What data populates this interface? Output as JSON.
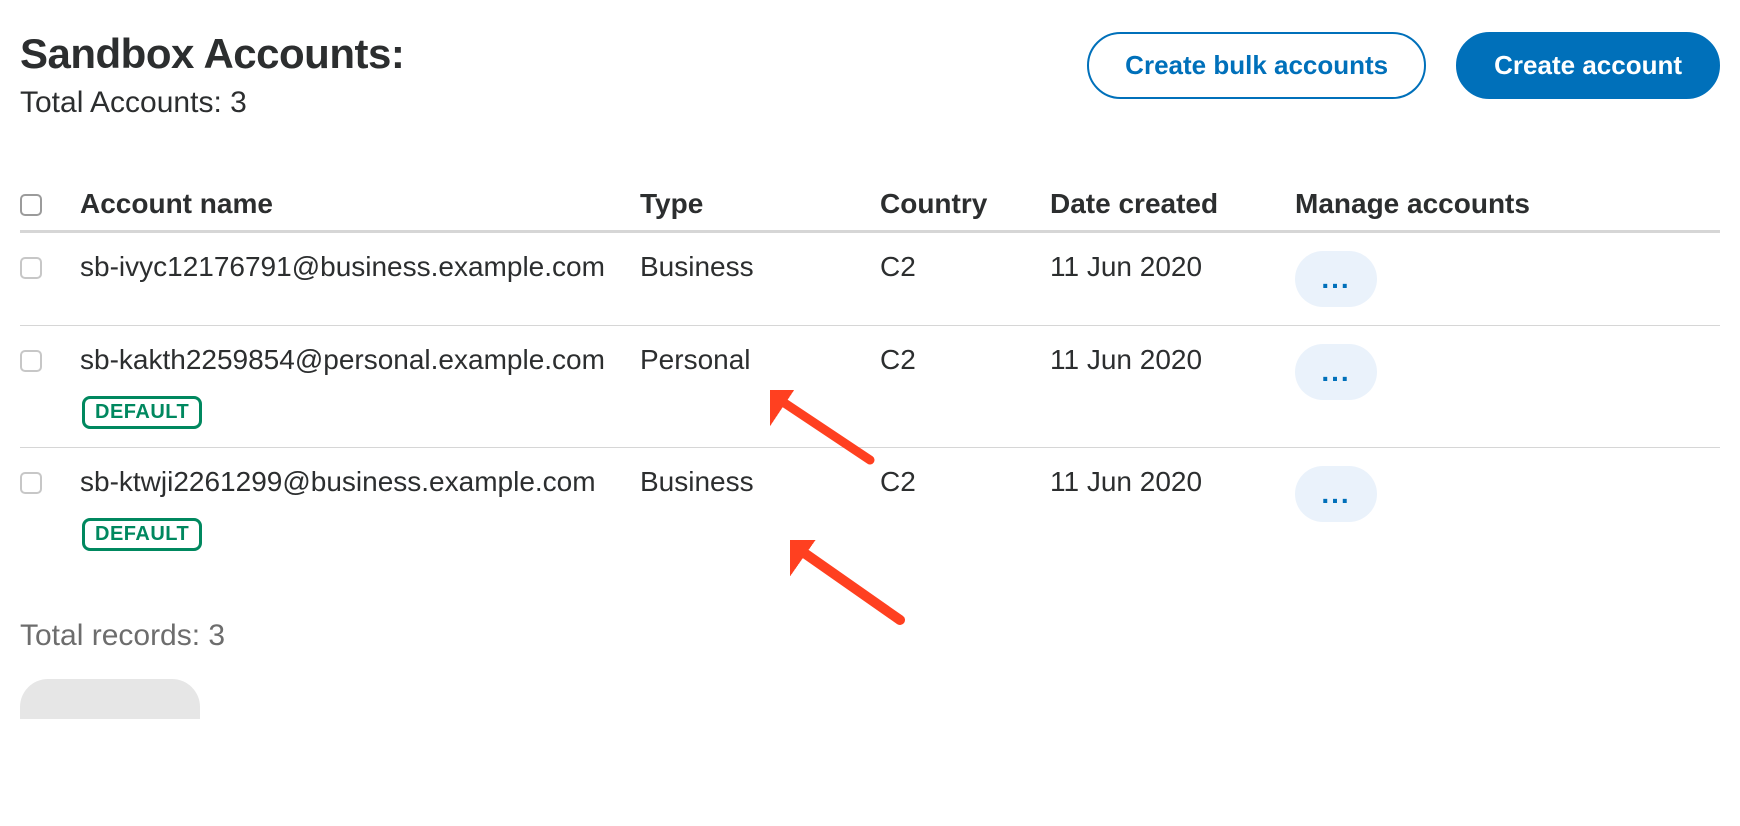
{
  "header": {
    "title": "Sandbox Accounts:",
    "total_label": "Total Accounts: 3",
    "buttons": {
      "bulk": "Create bulk accounts",
      "create": "Create account"
    }
  },
  "columns": {
    "c0": "",
    "c1": "Account name",
    "c2": "Type",
    "c3": "Country",
    "c4": "Date created",
    "c5": "Manage accounts"
  },
  "rows": [
    {
      "name": "sb-ivyc12176791@business.example.com",
      "type": "Business",
      "country": "C2",
      "date": "11 Jun 2020",
      "default": false
    },
    {
      "name": "sb-kakth2259854@personal.example.com",
      "type": "Personal",
      "country": "C2",
      "date": "11 Jun 2020",
      "default": true
    },
    {
      "name": "sb-ktwji2261299@business.example.com",
      "type": "Business",
      "country": "C2",
      "date": "11 Jun 2020",
      "default": true
    }
  ],
  "badge_label": "DEFAULT",
  "footer": "Total records: 3"
}
